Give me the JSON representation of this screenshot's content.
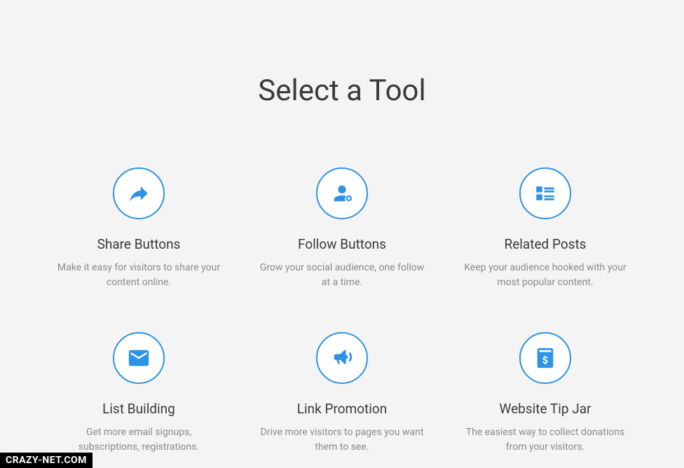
{
  "page": {
    "title": "Select a Tool"
  },
  "tools": [
    {
      "title": "Share Buttons",
      "description": "Make it easy for visitors to share your content online."
    },
    {
      "title": "Follow Buttons",
      "description": "Grow your social audience, one follow at a time."
    },
    {
      "title": "Related Posts",
      "description": "Keep your audience hooked with your most popular content."
    },
    {
      "title": "List Building",
      "description": "Get more email signups, subscriptions, registrations."
    },
    {
      "title": "Link Promotion",
      "description": "Drive more visitors to pages you want them to see."
    },
    {
      "title": "Website Tip Jar",
      "description": "The easiest way to collect donations from your visitors."
    }
  ],
  "watermark": "CRAZY-NET.COM"
}
